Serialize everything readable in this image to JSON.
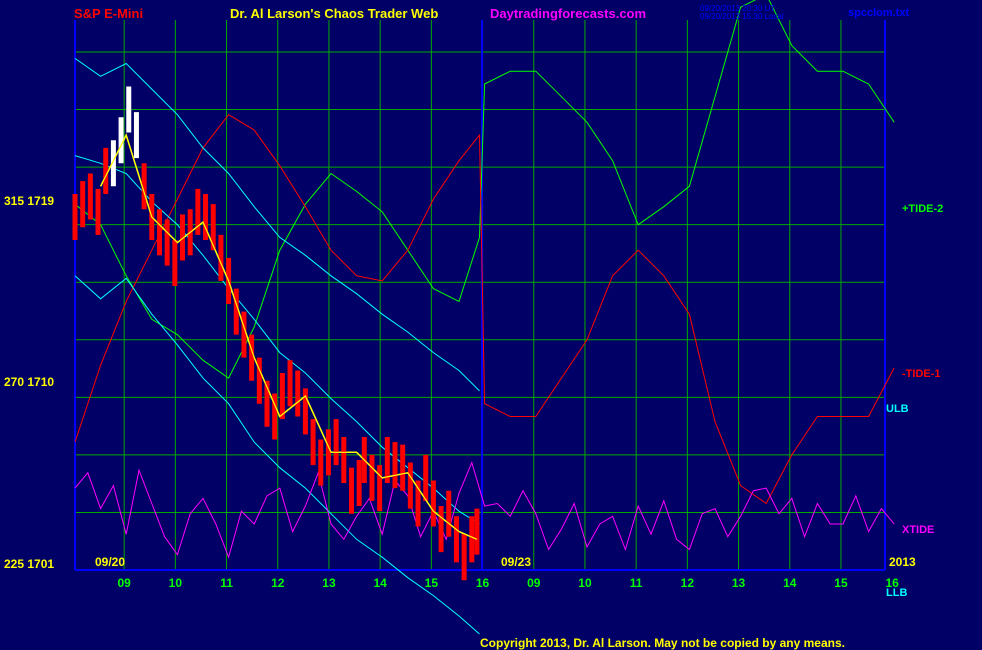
{
  "header": {
    "instrument": "S&P E-Mini",
    "title": "Dr. Al Larson's Chaos Trader Web",
    "site": "Daytradingforecasts.com",
    "stamp_line1": "09/20/2013 20:30 UT",
    "stamp_line2": "09/20/2013 15:30 Local",
    "file": "spcclom.txt"
  },
  "footer": {
    "copyright": "Copyright 2013, Dr. Al Larson. May not be copied by any means."
  },
  "colors": {
    "background": "#000066",
    "grid": "#00aa00",
    "price": "#ff0000",
    "price_recent": "#ffffff",
    "average": "#ffff00",
    "tide2": "#00ff00",
    "tide1": "#ff0000",
    "channel": "#00ffff",
    "xtide": "#ff00ff",
    "divider": "#0000ff"
  },
  "chart_data": {
    "type": "line",
    "x_axis": {
      "ticks": [
        "09",
        "10",
        "11",
        "12",
        "13",
        "14",
        "15",
        "16",
        "09",
        "10",
        "11",
        "12",
        "13",
        "14",
        "15",
        "16"
      ],
      "date_markers": [
        "09/20",
        "09/23",
        "2013"
      ],
      "units": "hour of day"
    },
    "y_axis": {
      "ticks": [
        "315 1719",
        "270 1710",
        "225 1701"
      ],
      "ylim": [
        1701,
        1722.5
      ]
    },
    "grid": true,
    "series": [
      {
        "name": "+TIDE-2",
        "kind": "forecast",
        "x": [
          0,
          0.5,
          1,
          1.5,
          2,
          2.5,
          3,
          3.5,
          4,
          4.5,
          5,
          5.5,
          6,
          6.5,
          7,
          7.5,
          7.9,
          8,
          8.5,
          9,
          9.5,
          10,
          10.5,
          11,
          11.5,
          12,
          12.5,
          13,
          13.5,
          14,
          14.5,
          15,
          15.5,
          16
        ],
        "values": [
          1715.3,
          1714.5,
          1712.5,
          1710.8,
          1710.2,
          1709.2,
          1708.5,
          1710.5,
          1713.5,
          1715.3,
          1716.5,
          1715.8,
          1715,
          1713.5,
          1712,
          1711.5,
          1714,
          1720,
          1720.5,
          1720.5,
          1719.5,
          1718.5,
          1717,
          1714.5,
          1715.2,
          1716,
          1719.5,
          1723,
          1723.5,
          1721.5,
          1720.5,
          1720.5,
          1720,
          1718.5
        ]
      },
      {
        "name": "-TIDE-1",
        "kind": "forecast",
        "x": [
          0,
          0.5,
          1,
          1.5,
          2,
          2.5,
          3,
          3.5,
          4,
          4.5,
          5,
          5.5,
          6,
          6.5,
          7,
          7.5,
          7.9,
          8,
          8.5,
          9,
          9.5,
          10,
          10.5,
          11,
          11.5,
          12,
          12.5,
          13,
          13.5,
          14,
          14.5,
          15,
          15.5,
          16
        ],
        "values": [
          1706,
          1709,
          1711.5,
          1713.5,
          1715.5,
          1717.5,
          1718.8,
          1718.2,
          1716.8,
          1715.2,
          1713.5,
          1712.5,
          1712.3,
          1713.5,
          1715.5,
          1717,
          1718,
          1707.5,
          1707,
          1707,
          1708.5,
          1710,
          1712.5,
          1713.5,
          1712.5,
          1711,
          1706.8,
          1704.3,
          1703.6,
          1705.5,
          1707,
          1707,
          1707,
          1708.9
        ]
      },
      {
        "name": "upper channel",
        "kind": "band",
        "x": [
          0,
          0.5,
          1,
          1.5,
          2,
          2.5,
          3,
          3.5,
          4,
          4.5,
          5,
          5.5,
          6,
          6.5,
          7,
          7.5,
          7.9
        ],
        "values": [
          1721,
          1720.3,
          1720.8,
          1719.8,
          1718.8,
          1717.5,
          1716.5,
          1715.2,
          1714,
          1713.3,
          1712.5,
          1711.8,
          1711,
          1710.3,
          1709.5,
          1708.8,
          1708
        ]
      },
      {
        "name": "middle channel",
        "kind": "band",
        "x": [
          0,
          0.5,
          1,
          1.5,
          2,
          2.5,
          3,
          3.5,
          4,
          4.5,
          5,
          5.5,
          6,
          6.5,
          7,
          7.5,
          7.9
        ],
        "values": [
          1717.2,
          1716.9,
          1716.5,
          1715.4,
          1714.5,
          1713.3,
          1712,
          1710.8,
          1709.5,
          1708.7,
          1707.7,
          1706.8,
          1705.8,
          1705,
          1704.2,
          1703.3,
          1702.8
        ]
      },
      {
        "name": "lower channel",
        "kind": "band",
        "x": [
          0,
          0.5,
          1,
          1.5,
          2,
          2.5,
          3,
          3.5,
          4,
          4.5,
          5,
          5.5,
          6,
          6.5,
          7,
          7.5,
          7.9
        ],
        "values": [
          1712.5,
          1711.6,
          1712.4,
          1711,
          1709.8,
          1708.5,
          1707.5,
          1706,
          1705,
          1704.2,
          1703.2,
          1702.2,
          1701.5,
          1700.7,
          1700,
          1699.2,
          1698.5
        ]
      },
      {
        "name": "XTIDE",
        "kind": "cycle",
        "x": [
          0,
          0.25,
          0.5,
          0.75,
          1,
          1.25,
          1.5,
          1.75,
          2,
          2.25,
          2.5,
          2.75,
          3,
          3.25,
          3.5,
          3.75,
          4,
          4.25,
          4.5,
          4.75,
          5,
          5.25,
          5.5,
          5.75,
          6,
          6.25,
          6.5,
          6.75,
          7,
          7.25,
          7.5,
          7.75,
          8,
          8.25,
          8.5,
          8.75,
          9,
          9.25,
          9.5,
          9.75,
          10,
          10.25,
          10.5,
          10.75,
          11,
          11.25,
          11.5,
          11.75,
          12,
          12.25,
          12.5,
          12.75,
          13,
          13.25,
          13.5,
          13.75,
          14,
          14.25,
          14.5,
          14.75,
          15,
          15.25,
          15.5,
          15.75,
          16
        ],
        "values": [
          1704.2,
          1704.8,
          1703.4,
          1704.3,
          1702.4,
          1704.9,
          1703.6,
          1702.3,
          1701.6,
          1703.2,
          1703.8,
          1702.8,
          1701.5,
          1703.3,
          1702.8,
          1703.9,
          1704.2,
          1702.5,
          1703.5,
          1704.8,
          1702.8,
          1702.2,
          1703.1,
          1703.8,
          1702.4,
          1704.5,
          1703.9,
          1702.3,
          1703.3,
          1702.2,
          1704,
          1705.2,
          1703.5,
          1703.6,
          1703.1,
          1704.1,
          1703.2,
          1701.8,
          1702.6,
          1703.6,
          1701.9,
          1702.8,
          1703.1,
          1701.8,
          1703.5,
          1702.4,
          1703.7,
          1702.2,
          1701.8,
          1703.2,
          1703.4,
          1702.3,
          1703.1,
          1704.1,
          1704.2,
          1703.2,
          1703.8,
          1702.3,
          1703.6,
          1702.8,
          1702.8,
          1703.9,
          1702.5,
          1703.4,
          1702.8
        ]
      },
      {
        "name": "price",
        "kind": "bars",
        "x": [
          0,
          0.15,
          0.3,
          0.45,
          0.6,
          0.75,
          0.9,
          1.05,
          1.2,
          1.35,
          1.5,
          1.65,
          1.8,
          1.95,
          2.1,
          2.25,
          2.4,
          2.55,
          2.7,
          2.85,
          3,
          3.15,
          3.3,
          3.45,
          3.6,
          3.75,
          3.9,
          4.05,
          4.2,
          4.35,
          4.5,
          4.65,
          4.8,
          4.95,
          5.1,
          5.25,
          5.4,
          5.55,
          5.65,
          5.8,
          5.95,
          6.1,
          6.25,
          6.4,
          6.55,
          6.7,
          6.85,
          7,
          7.15,
          7.3,
          7.45,
          7.6,
          7.75,
          7.85
        ],
        "values": [
          1714.8,
          1715.3,
          1715.6,
          1715,
          1716.6,
          1716.9,
          1717.8,
          1719,
          1718,
          1716,
          1714.8,
          1714.2,
          1713.8,
          1713,
          1714,
          1714.2,
          1715,
          1714.8,
          1714.4,
          1713.2,
          1712.3,
          1711.1,
          1710.2,
          1709.3,
          1708.4,
          1707.5,
          1707,
          1707.8,
          1708.3,
          1707.9,
          1707.2,
          1706,
          1705.2,
          1705.6,
          1706,
          1705.3,
          1704.1,
          1704.4,
          1705.3,
          1704.6,
          1704.2,
          1705.3,
          1705.1,
          1705,
          1704.3,
          1703.6,
          1704.6,
          1703.6,
          1702.6,
          1703.2,
          1702.2,
          1701.5,
          1702.2,
          1702.5
        ]
      },
      {
        "name": "average",
        "kind": "line",
        "x": [
          0.5,
          1,
          1.5,
          2,
          2.5,
          3,
          3.5,
          4,
          4.5,
          5,
          5.5,
          6,
          6.5,
          7,
          7.5,
          7.85
        ],
        "values": [
          1716,
          1718,
          1714.8,
          1713.8,
          1714.6,
          1712.3,
          1709.3,
          1707,
          1707.8,
          1705.6,
          1705.6,
          1704.6,
          1704.8,
          1703.3,
          1702.5,
          1702.2
        ]
      }
    ],
    "right_labels": [
      "+TIDE-2",
      "-TIDE-1",
      "ULB",
      "XTIDE",
      "LLB"
    ]
  }
}
